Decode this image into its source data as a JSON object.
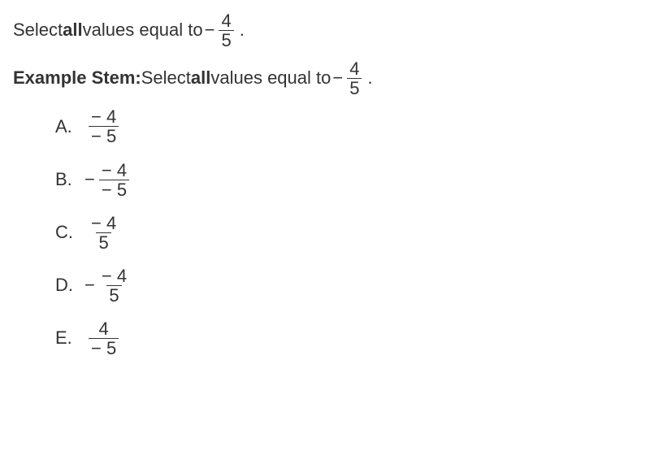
{
  "line1": {
    "t1": "Select ",
    "t2": "all",
    "t3": " values equal to ",
    "neg": "−",
    "num": "4",
    "den": "5",
    "period": "."
  },
  "line2": {
    "label": "Example Stem:",
    "t1": " Select ",
    "t2": "all",
    "t3": " values equal to ",
    "neg": "−",
    "num": "4",
    "den": "5",
    "period": "."
  },
  "options": {
    "A": {
      "letter": "A.",
      "leading_neg": "",
      "num": "− 4",
      "den": "− 5"
    },
    "B": {
      "letter": "B.",
      "leading_neg": "−",
      "num": "− 4",
      "den": "− 5"
    },
    "C": {
      "letter": "C.",
      "leading_neg": "",
      "num": "− 4",
      "den": "5"
    },
    "D": {
      "letter": "D.",
      "leading_neg": "−",
      "num": "− 4",
      "den": "5"
    },
    "E": {
      "letter": "E.",
      "leading_neg": "",
      "num": "4",
      "den": "− 5"
    }
  }
}
